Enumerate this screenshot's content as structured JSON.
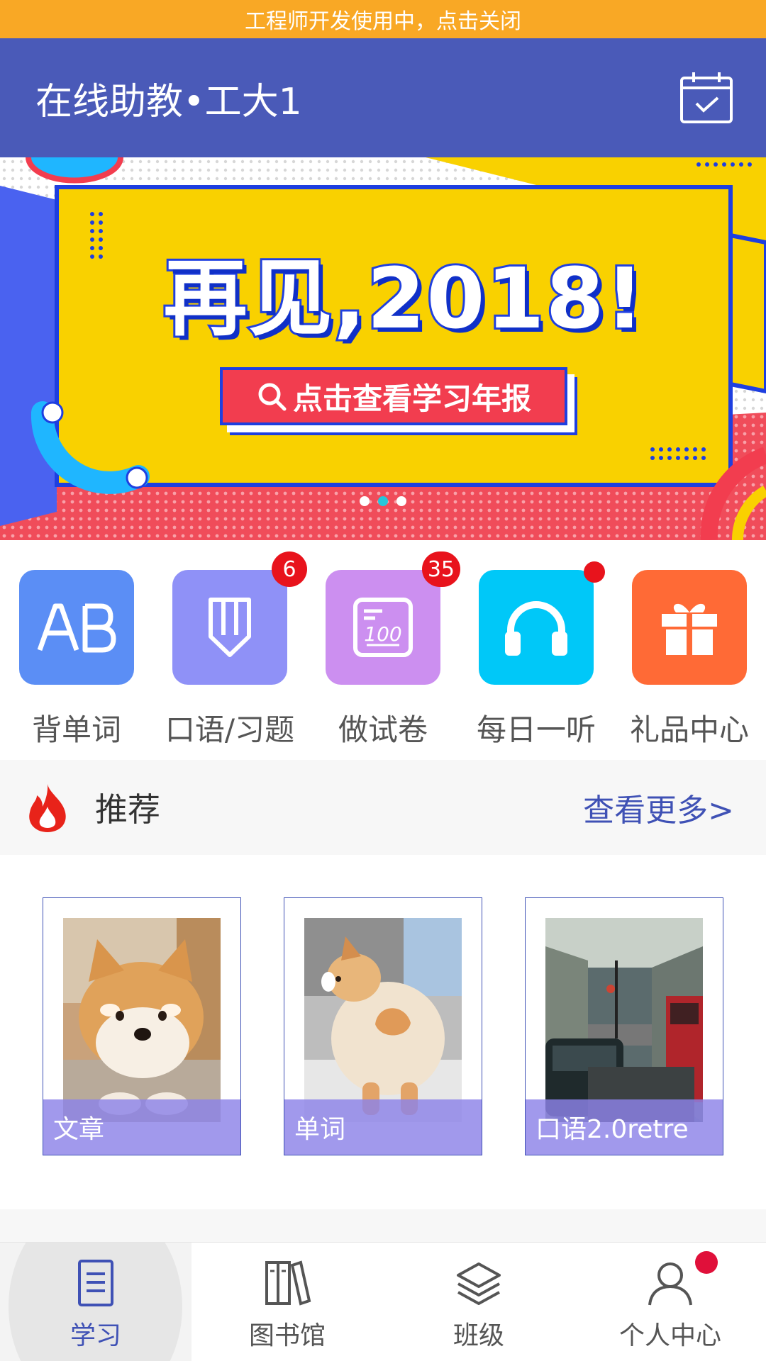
{
  "dev_notice": "工程师开发使用中，点击关闭",
  "app_bar": {
    "title": "在线助教•工大1",
    "action_icon": "calendar-check-icon"
  },
  "banner": {
    "title": "再见,2018!",
    "button_label": "点击查看学习年报",
    "slides": 3,
    "active_slide": 2,
    "colors": {
      "yellow": "#f9d100",
      "blue": "#2040e0",
      "red": "#f23d4f",
      "cyan": "#1fb6ff"
    }
  },
  "quick_menu": [
    {
      "label": "背单词",
      "icon": "ab-letters-icon",
      "color": "#5b8ef5",
      "badge": ""
    },
    {
      "label": "口语/习题",
      "icon": "pencil-icon",
      "color": "#8f91f7",
      "badge": "6"
    },
    {
      "label": "做试卷",
      "icon": "score-100-icon",
      "color": "#cc8ff0",
      "badge": "35"
    },
    {
      "label": "每日一听",
      "icon": "headphones-icon",
      "color": "#00c8f8",
      "badge": "",
      "dot": true
    },
    {
      "label": "礼品中心",
      "icon": "gift-icon",
      "color": "#ff6a36",
      "badge": ""
    }
  ],
  "recommend": {
    "title": "推荐",
    "more": "查看更多>",
    "cards": [
      {
        "label": "文章",
        "image": "shiba-dog-photo"
      },
      {
        "label": "单词",
        "image": "corgi-back-photo"
      },
      {
        "label": "口语2.0retre",
        "image": "london-street-photo"
      }
    ]
  },
  "bottom_nav": [
    {
      "label": "学习",
      "icon": "document-list-icon",
      "active": true
    },
    {
      "label": "图书馆",
      "icon": "books-icon",
      "active": false
    },
    {
      "label": "班级",
      "icon": "layers-icon",
      "active": false
    },
    {
      "label": "个人中心",
      "icon": "person-icon",
      "active": false,
      "dot": true
    }
  ]
}
